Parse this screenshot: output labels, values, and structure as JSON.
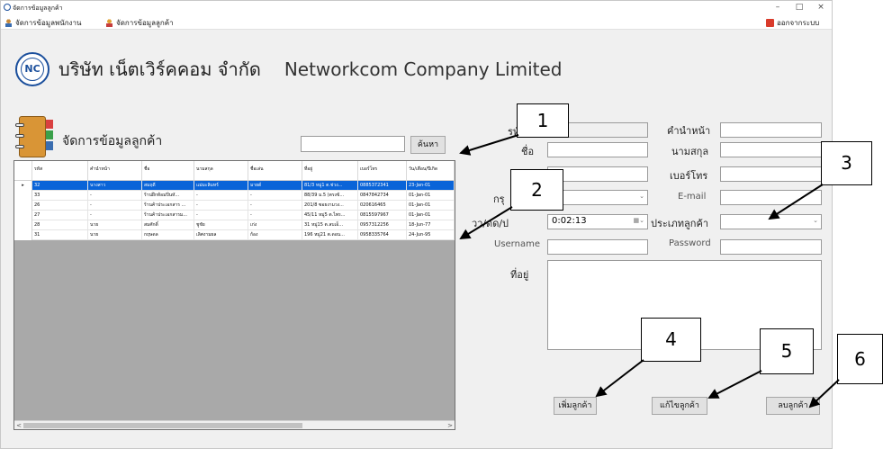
{
  "window": {
    "title": "จัดการข้อมูลลูกค้า",
    "minimize_symbol": "–",
    "maximize_symbol": "□",
    "close_symbol": "×"
  },
  "menubar": {
    "items": [
      {
        "label": "จัดการข้อมูลพนักงาน",
        "icon": "employee-icon"
      },
      {
        "label": "จัดการข้อมูลลูกค้า",
        "icon": "customer-icon"
      }
    ],
    "logout_label": "ออกจากระบบ"
  },
  "header": {
    "company_th": "บริษัท เน็ตเวิร์คคอม จำกัด",
    "company_en": "Networkcom Company Limited"
  },
  "section": {
    "title": "จัดการข้อมูลลูกค้า"
  },
  "search": {
    "value": "",
    "button_label": "ค้นหา"
  },
  "grid": {
    "columns": [
      "รหัส",
      "คำนำหน้า",
      "ชื่อ",
      "นามสกุล",
      "ชื่อเล่น",
      "ที่อยู่",
      "เบอร์โทร",
      "วัน/เดือน/ปีเกิด"
    ],
    "rows": [
      {
        "selected": true,
        "cells": [
          "32",
          "นางสาว",
          "สมฤดี",
          "แม่มะลิมหร์",
          "มายด์",
          "81/3 หมู่1 ต.ช่วง...",
          "0885372341",
          "23-Jan-01"
        ]
      },
      {
        "selected": false,
        "cells": [
          "33",
          "-",
          "ร้านฝึกท้อมปิ่นหั...",
          "-",
          "-",
          "88/39 ม.5 (ตรงข้...",
          "0847842734",
          "01-Jan-01"
        ]
      },
      {
        "selected": false,
        "cells": [
          "26",
          "-",
          "ร้านค้าประเอกสาร ...",
          "-",
          "-",
          "201/8 ซอยงามวง...",
          "020616465",
          "01-Jan-01"
        ]
      },
      {
        "selected": false,
        "cells": [
          "27",
          "-",
          "ร้านค้าประเอกสารม...",
          "-",
          "-",
          "45/11 หมู่5 ต.ไพร...",
          "0815597967",
          "01-Jan-01"
        ]
      },
      {
        "selected": false,
        "cells": [
          "28",
          "นาย",
          "สมศักดิ์",
          "ชูชัย",
          "เก่ง",
          "31 หมู่15 ต.ลบเอ็...",
          "0957312256",
          "18-Jun-77"
        ]
      },
      {
        "selected": false,
        "cells": [
          "31",
          "นาย",
          "กฤษดล",
          "เลิศงามผล",
          "ก้อง",
          "196 หมู่21 ต.ดอน...",
          "0958335764",
          "24-Jun-95"
        ]
      }
    ],
    "selected_marker": "▸",
    "scroll_left": "<",
    "scroll_right": ">"
  },
  "form": {
    "id_label": "รหั",
    "id_value": "",
    "prefix_label": "คำนำหน้า",
    "prefix_value": "",
    "name_label": "ชื่อ",
    "name_value": "",
    "surname_label": "นามสกุล",
    "surname_value": "",
    "phone_label": "เบอร์โทร",
    "phone_value": "",
    "group_label": "กรุ",
    "group_value": "",
    "email_label": "E-mail",
    "email_value": "",
    "birthdate_label": "วว/ดด/ป",
    "birthdate_value": "0:02:13",
    "customer_type_label": "ประเภทลูกค้า",
    "customer_type_value": "",
    "username_label": "Username",
    "username_value": "",
    "password_label": "Password",
    "password_value": "",
    "address_label": "ที่อยู่",
    "address_value": ""
  },
  "actions": {
    "add_label": "เพิ่มลูกค้า",
    "edit_label": "แก้ไขลูกค้า",
    "delete_label": "ลบลูกค้า"
  },
  "callouts": [
    "1",
    "2",
    "3",
    "4",
    "5",
    "6"
  ]
}
